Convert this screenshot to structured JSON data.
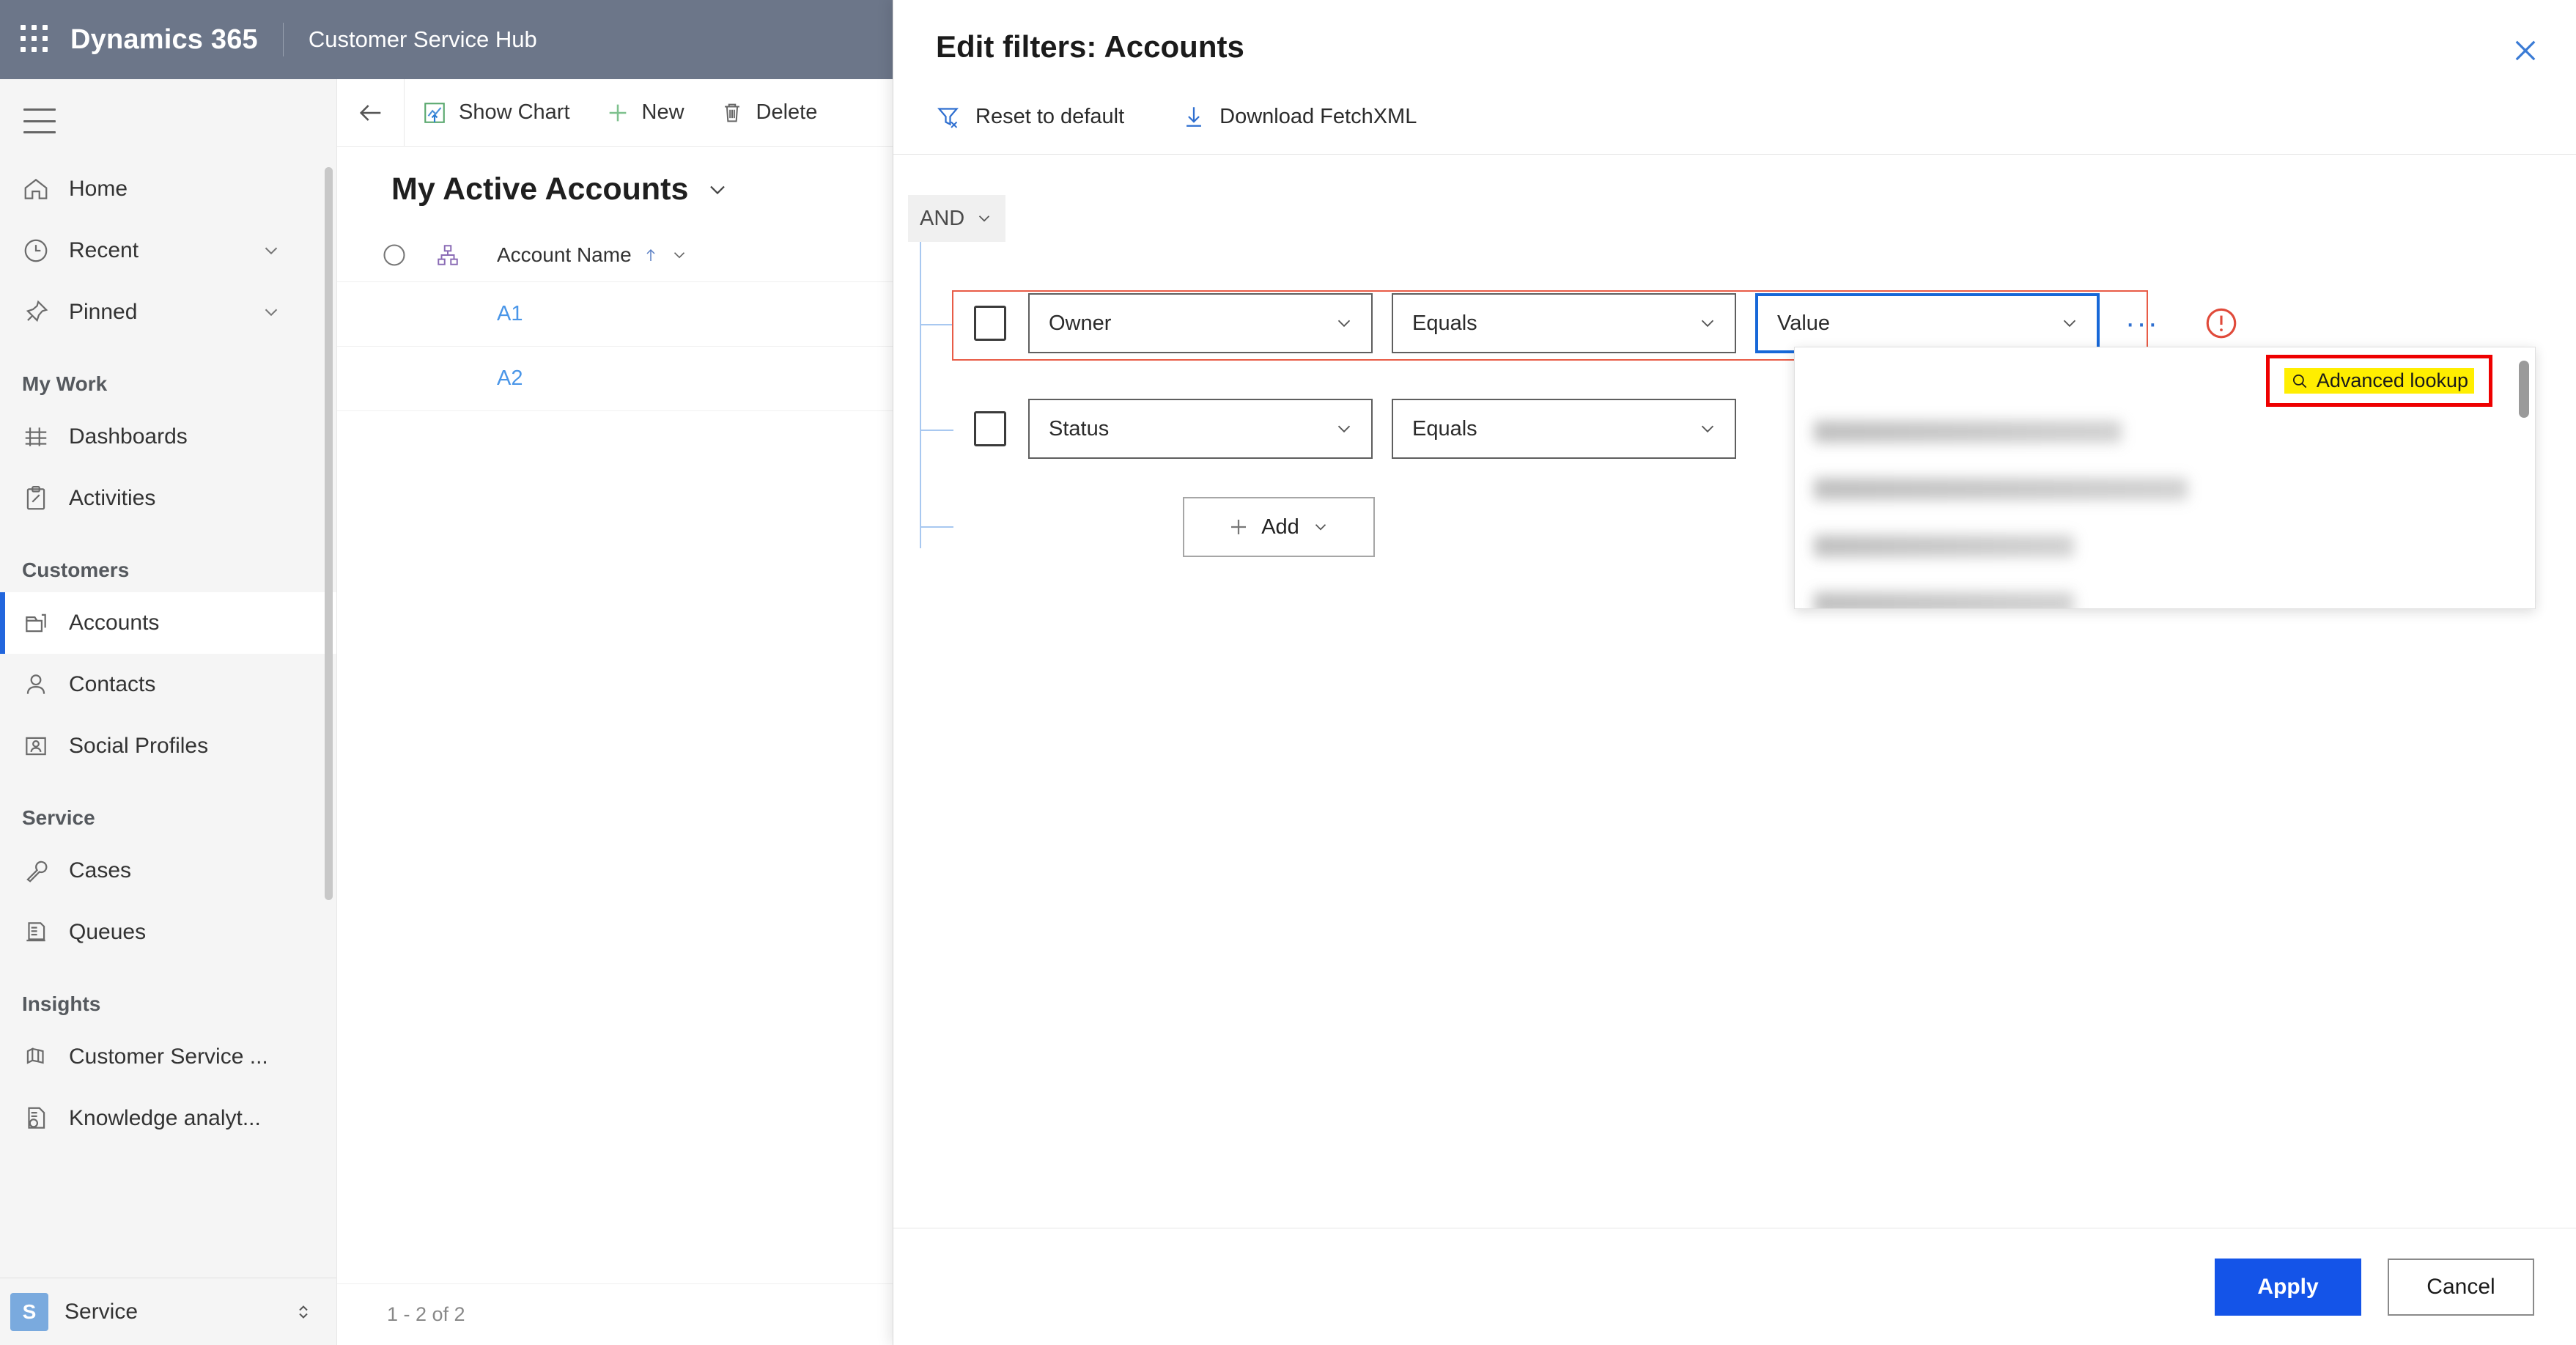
{
  "header": {
    "waffle_icon": "waffle-grid-icon",
    "brand": "Dynamics 365",
    "app_name": "Customer Service Hub",
    "background": "#6c7689"
  },
  "sidebar": {
    "hamburger_icon": "hamburger-menu-icon",
    "items": [
      {
        "label": "Home",
        "icon": "home-icon",
        "expandable": false,
        "selected": false
      },
      {
        "label": "Recent",
        "icon": "clock-icon",
        "expandable": true,
        "selected": false
      },
      {
        "label": "Pinned",
        "icon": "pin-icon",
        "expandable": true,
        "selected": false
      }
    ],
    "groups": [
      {
        "title": "My Work",
        "items": [
          {
            "label": "Dashboards",
            "icon": "dashboard-icon",
            "selected": false
          },
          {
            "label": "Activities",
            "icon": "clipboard-icon",
            "selected": false
          }
        ]
      },
      {
        "title": "Customers",
        "items": [
          {
            "label": "Accounts",
            "icon": "accounts-icon",
            "selected": true
          },
          {
            "label": "Contacts",
            "icon": "person-icon",
            "selected": false
          },
          {
            "label": "Social Profiles",
            "icon": "social-profile-icon",
            "selected": false
          }
        ]
      },
      {
        "title": "Service",
        "items": [
          {
            "label": "Cases",
            "icon": "wrench-icon",
            "selected": false
          },
          {
            "label": "Queues",
            "icon": "queue-icon",
            "selected": false
          }
        ]
      },
      {
        "title": "Insights",
        "items": [
          {
            "label": "Customer Service ...",
            "icon": "bar-chart-icon",
            "selected": false
          },
          {
            "label": "Knowledge analyt...",
            "icon": "knowledge-icon",
            "selected": false
          }
        ]
      }
    ],
    "area_switcher": {
      "badge": "S",
      "label": "Service",
      "caret_icon": "updown-caret-icon"
    }
  },
  "main": {
    "command_bar": {
      "back_icon": "back-arrow-icon",
      "buttons": [
        {
          "label": "Show Chart",
          "icon": "chart-icon"
        },
        {
          "label": "New",
          "icon": "plus-icon"
        },
        {
          "label": "Delete",
          "icon": "trash-icon"
        }
      ]
    },
    "view_title": "My Active Accounts",
    "view_title_caret": "chevron-down-icon",
    "grid": {
      "select_all_icon": "select-all-circle-icon",
      "hierarchy_icon": "hierarchy-icon",
      "columns": [
        {
          "label": "Account Name",
          "sort_icon": "sort-asc-arrow-icon",
          "menu_icon": "chevron-down-icon"
        }
      ],
      "rows": [
        {
          "account_name": "A1"
        },
        {
          "account_name": "A2"
        }
      ]
    },
    "record_count": "1 - 2 of 2"
  },
  "panel": {
    "title": "Edit filters: Accounts",
    "close_icon": "close-icon",
    "toolbar": [
      {
        "label": "Reset to default",
        "icon": "filter-reset-icon"
      },
      {
        "label": "Download FetchXML",
        "icon": "download-arrow-icon"
      }
    ],
    "logic_operator": {
      "label": "AND",
      "caret_icon": "chevron-down-icon"
    },
    "filter_rows": [
      {
        "checkbox_checked": false,
        "field": {
          "value": "Owner",
          "caret_icon": "chevron-down-icon"
        },
        "operator": {
          "value": "Equals",
          "caret_icon": "chevron-down-icon"
        },
        "value": {
          "value": "Value",
          "caret_icon": "chevron-down-icon",
          "focused": true
        },
        "more_icon": "ellipsis-icon",
        "error_icon": "error-circle-icon",
        "has_error": true
      },
      {
        "checkbox_checked": false,
        "field": {
          "value": "Status",
          "caret_icon": "chevron-down-icon"
        },
        "operator": {
          "value": "Equals",
          "caret_icon": "chevron-down-icon"
        },
        "has_error": false
      }
    ],
    "add_button": {
      "label": "Add",
      "plus_icon": "plus-icon",
      "caret_icon": "chevron-down-icon"
    },
    "lookup_dropdown": {
      "advanced_lookup": {
        "label": "Advanced lookup",
        "icon": "search-icon"
      },
      "highlight_color": "#ffee00",
      "annotation_border_color": "#ee0000",
      "scrollbar_icon": "scrollbar-thumb-icon",
      "items_blurred_count": 8
    },
    "footer": {
      "apply_label": "Apply",
      "cancel_label": "Cancel",
      "apply_color": "#1454e8"
    }
  }
}
